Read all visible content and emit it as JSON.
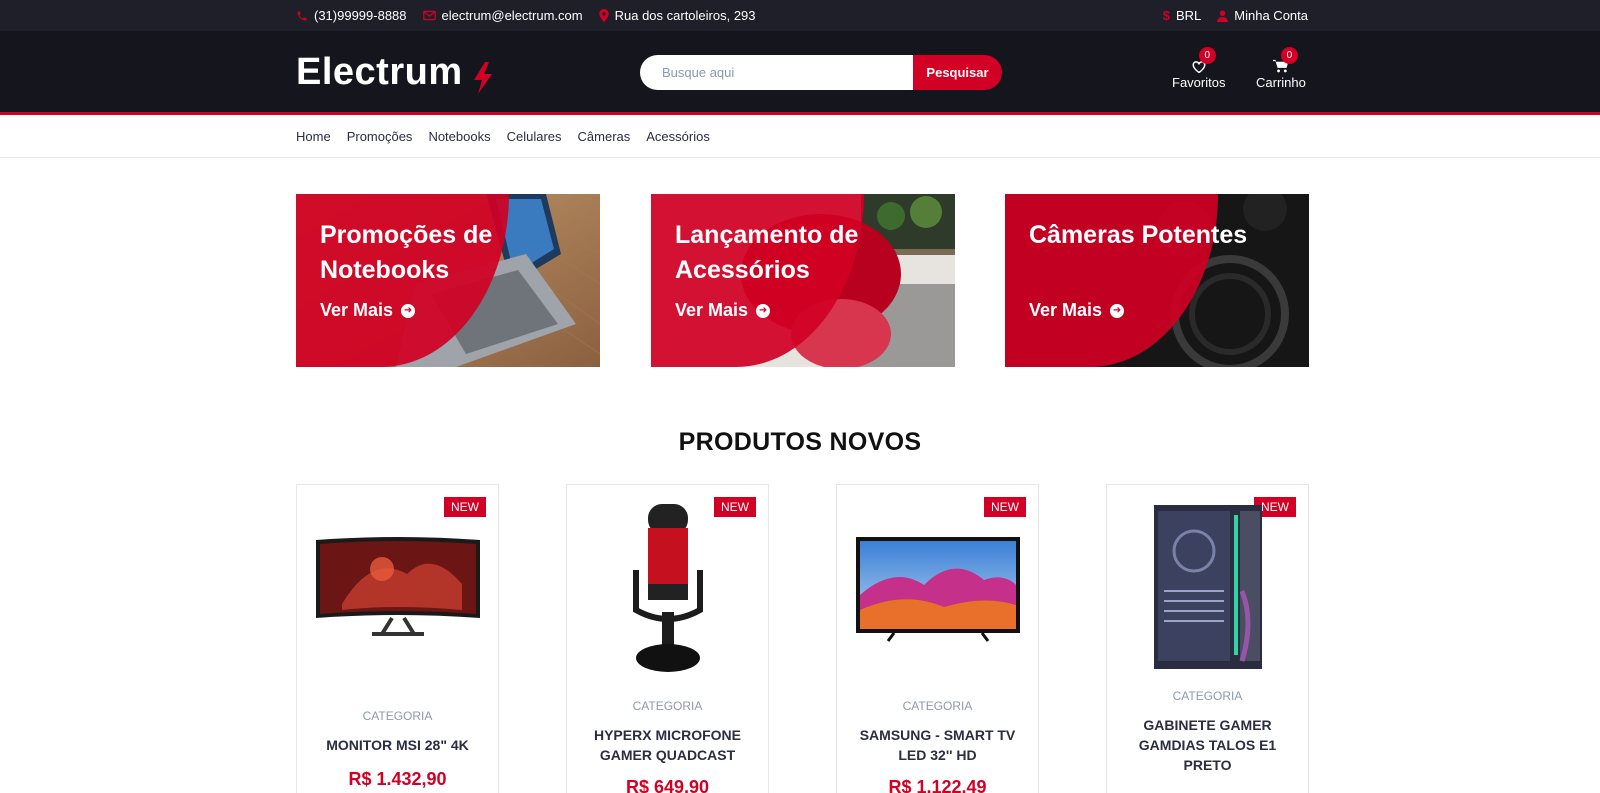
{
  "topbar": {
    "phone": "(31)99999-8888",
    "email": "electrum@electrum.com",
    "address": "Rua dos cartoleiros, 293",
    "currency": "BRL",
    "account": "Minha Conta",
    "icons": [
      "phone-icon",
      "envelope-icon",
      "map-marker-icon",
      "dollar-icon",
      "user-icon"
    ]
  },
  "header": {
    "logo": "Electrum",
    "search": {
      "placeholder": "Busque aqui",
      "button": "Pesquisar"
    },
    "favorites": {
      "label": "Favoritos",
      "count": "0"
    },
    "cart": {
      "label": "Carrinho",
      "count": "0"
    }
  },
  "nav": {
    "items": [
      "Home",
      "Promoções",
      "Notebooks",
      "Celulares",
      "Câmeras",
      "Acessórios"
    ]
  },
  "collections": [
    {
      "title": "Promoções de Notebooks",
      "cta": "Ver Mais"
    },
    {
      "title": "Lançamento de Acessórios",
      "cta": "Ver Mais"
    },
    {
      "title": "Câmeras Potentes",
      "cta": "Ver Mais"
    }
  ],
  "section": {
    "title": "PRODUTOS NOVOS"
  },
  "products": [
    {
      "badge": "NEW",
      "category": "CATEGORIA",
      "name": "MONITOR MSI 28\" 4K",
      "price": "R$ 1.432,90"
    },
    {
      "badge": "NEW",
      "category": "CATEGORIA",
      "name": "HYPERX MICROFONE GAMER QUADCAST",
      "price": "R$ 649,90"
    },
    {
      "badge": "NEW",
      "category": "CATEGORIA",
      "name": "SAMSUNG - SMART TV LED 32'' HD",
      "price": "R$ 1.122,49"
    },
    {
      "badge": "NEW",
      "category": "CATEGORIA",
      "name": "GABINETE GAMER GAMDIAS TALOS E1 PRETO",
      "price": ""
    }
  ],
  "colors": {
    "accent": "#d10024",
    "dark": "#15161d",
    "topbar": "#1e1f29"
  }
}
